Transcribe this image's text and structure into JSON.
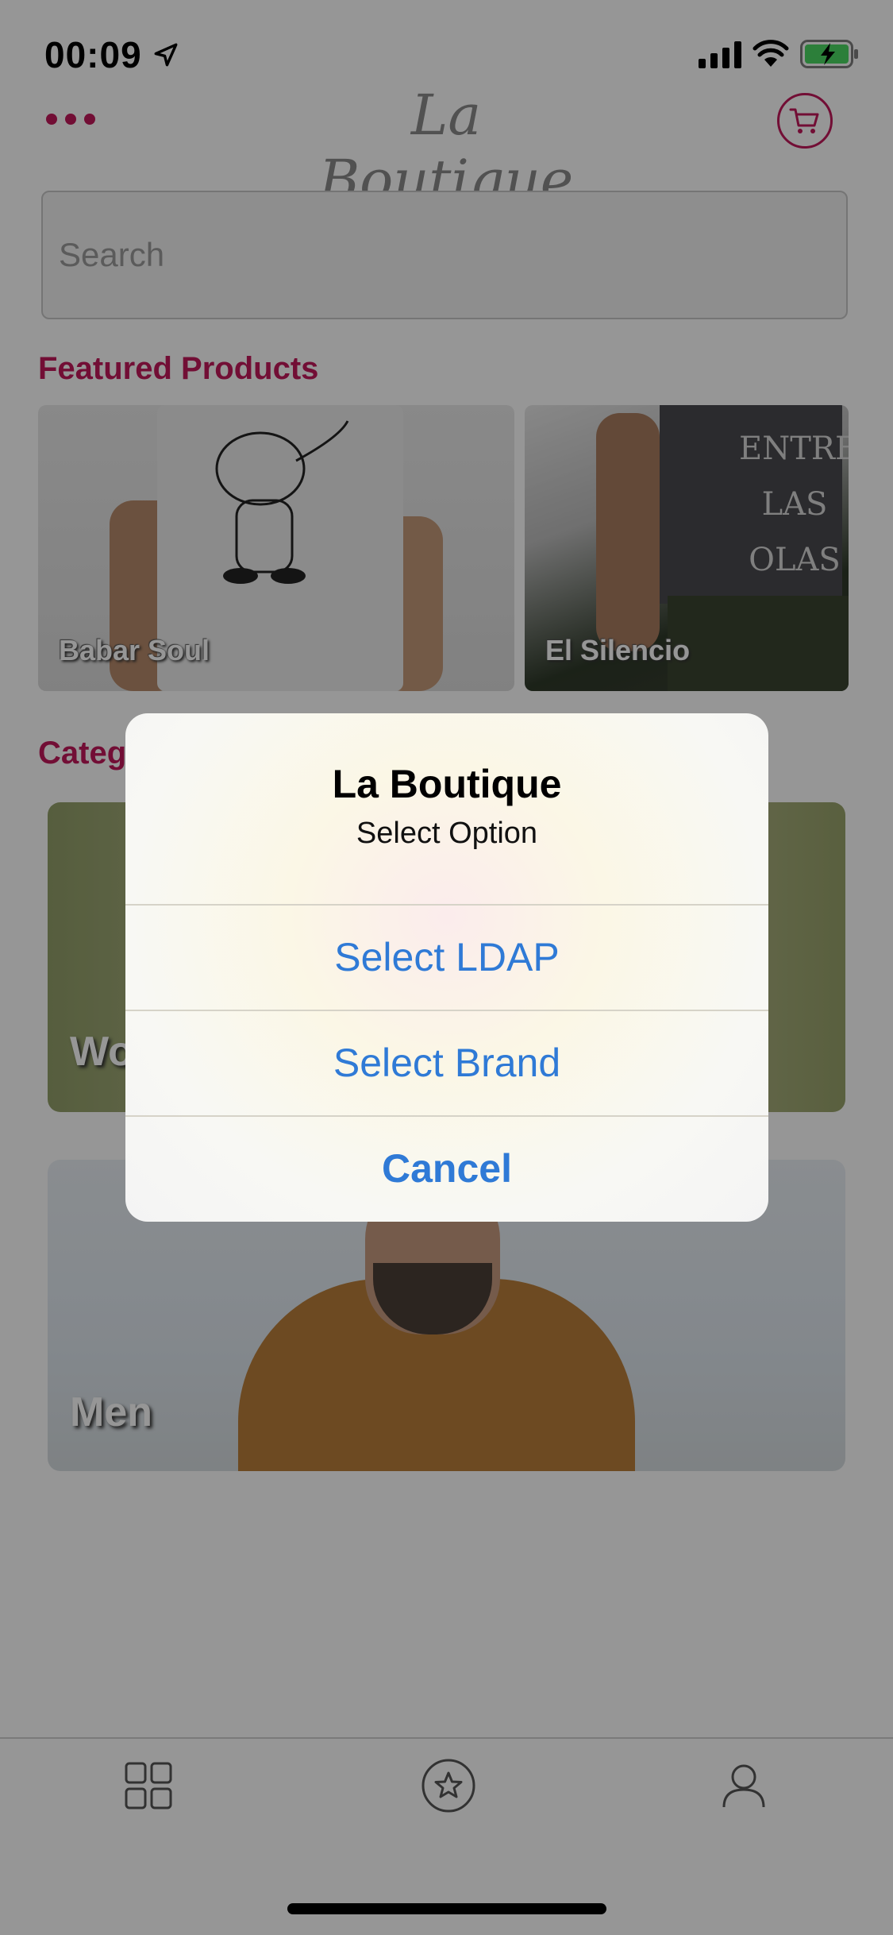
{
  "status_bar": {
    "time": "00:09",
    "icons": [
      "location-arrow-icon",
      "cellular-signal-icon",
      "wifi-icon",
      "battery-charging-icon"
    ]
  },
  "header": {
    "brand": "La Boutique",
    "menu_icon": "more-dots-icon",
    "cart_icon": "cart-icon",
    "accent_color": "#c2185b"
  },
  "search": {
    "placeholder": "Search",
    "value": ""
  },
  "featured": {
    "title": "Featured Products",
    "products": [
      {
        "name": "Babar Soul"
      },
      {
        "name": "El Silencio",
        "shirt_text": "ENTRE LAS OLAS"
      }
    ]
  },
  "categories": {
    "title": "Categ",
    "items": [
      {
        "label": "Wo"
      },
      {
        "label": "Men"
      }
    ]
  },
  "tab_bar": {
    "tabs": [
      {
        "icon": "grid-icon"
      },
      {
        "icon": "star-icon"
      },
      {
        "icon": "profile-icon"
      }
    ]
  },
  "alert": {
    "title": "La Boutique",
    "message": "Select Option",
    "buttons": [
      {
        "label": "Select LDAP"
      },
      {
        "label": "Select Brand"
      },
      {
        "label": "Cancel"
      }
    ],
    "button_color": "#2f7ad6"
  }
}
